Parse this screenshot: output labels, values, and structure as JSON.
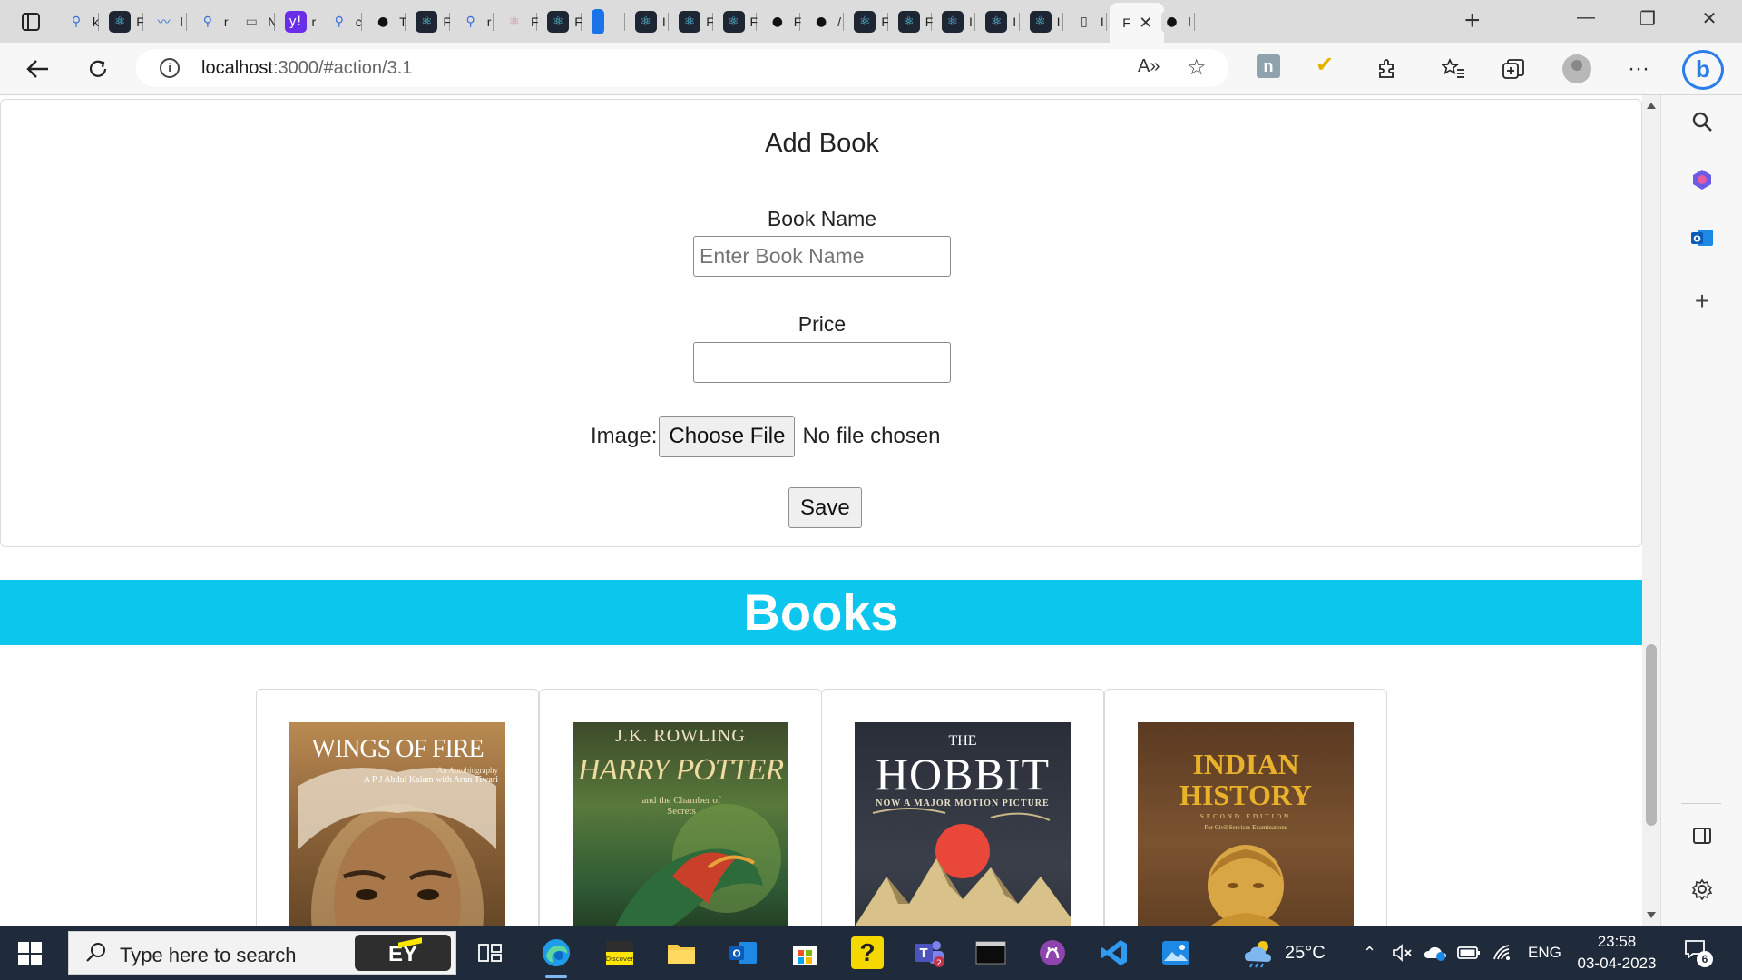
{
  "browser": {
    "tabs": [
      {
        "icon": "tab-actions-icon"
      },
      {
        "icon": "search-favicon",
        "label": "k"
      },
      {
        "icon": "react-favicon",
        "label": "F"
      },
      {
        "icon": "chart-favicon",
        "label": "l"
      },
      {
        "icon": "search-favicon",
        "label": "r"
      },
      {
        "icon": "monitor-favicon",
        "label": "N"
      },
      {
        "icon": "yahoo-favicon",
        "label": "r"
      },
      {
        "icon": "search-favicon",
        "label": "c"
      },
      {
        "icon": "github-favicon",
        "label": "T"
      },
      {
        "icon": "react-favicon",
        "label": "F"
      },
      {
        "icon": "search-favicon",
        "label": "r"
      },
      {
        "icon": "react-pink-favicon",
        "label": "F"
      },
      {
        "icon": "react-favicon",
        "label": "F"
      },
      {
        "icon": "blue-block-favicon",
        "label": ""
      },
      {
        "icon": "react-favicon",
        "label": "I"
      },
      {
        "icon": "react-favicon",
        "label": "F"
      },
      {
        "icon": "react-favicon",
        "label": "F"
      },
      {
        "icon": "github-favicon",
        "label": "F"
      },
      {
        "icon": "github-favicon",
        "label": "/"
      },
      {
        "icon": "react-favicon",
        "label": "F"
      },
      {
        "icon": "react-favicon",
        "label": "F"
      },
      {
        "icon": "react-favicon",
        "label": "I"
      },
      {
        "icon": "react-favicon",
        "label": "I"
      },
      {
        "icon": "react-favicon",
        "label": "I"
      },
      {
        "icon": "page-favicon",
        "label": "I"
      },
      {
        "icon": "active-tab",
        "label": "F"
      },
      {
        "icon": "github-favicon",
        "label": "l"
      }
    ],
    "url_host": "localhost",
    "url_path": ":3000/#action/3.1"
  },
  "form": {
    "title": "Add Book",
    "book_name_label": "Book Name",
    "book_name_placeholder": "Enter Book Name",
    "book_name_value": "",
    "price_label": "Price",
    "price_value": "",
    "image_label": "Image:",
    "choose_file_label": "Choose File",
    "no_file_text": "No file chosen",
    "save_label": "Save"
  },
  "books_heading": "Books",
  "books": [
    {
      "title_line1": "WINGS OF FIRE",
      "subtitle": "An Autobiography",
      "author": "A P J Abdul Kalam with Arun Tiwari"
    },
    {
      "author": "J.K. ROWLING",
      "title_line1": "HARRY POTTER",
      "subtitle": "and the Chamber of Secrets"
    },
    {
      "prefix": "THE",
      "title_line1": "HOBBIT",
      "subtitle": "NOW A MAJOR MOTION PICTURE"
    },
    {
      "title_line1": "INDIAN",
      "title_line2": "HISTORY",
      "edition": "SECOND EDITION",
      "subtitle": "For Civil Services Examinations"
    }
  ],
  "taskbar": {
    "search_placeholder": "Type here to search",
    "ey_label": "EY",
    "temperature": "25°C",
    "language": "ENG",
    "time": "23:58",
    "date": "03-04-2023",
    "notification_count": "6"
  }
}
